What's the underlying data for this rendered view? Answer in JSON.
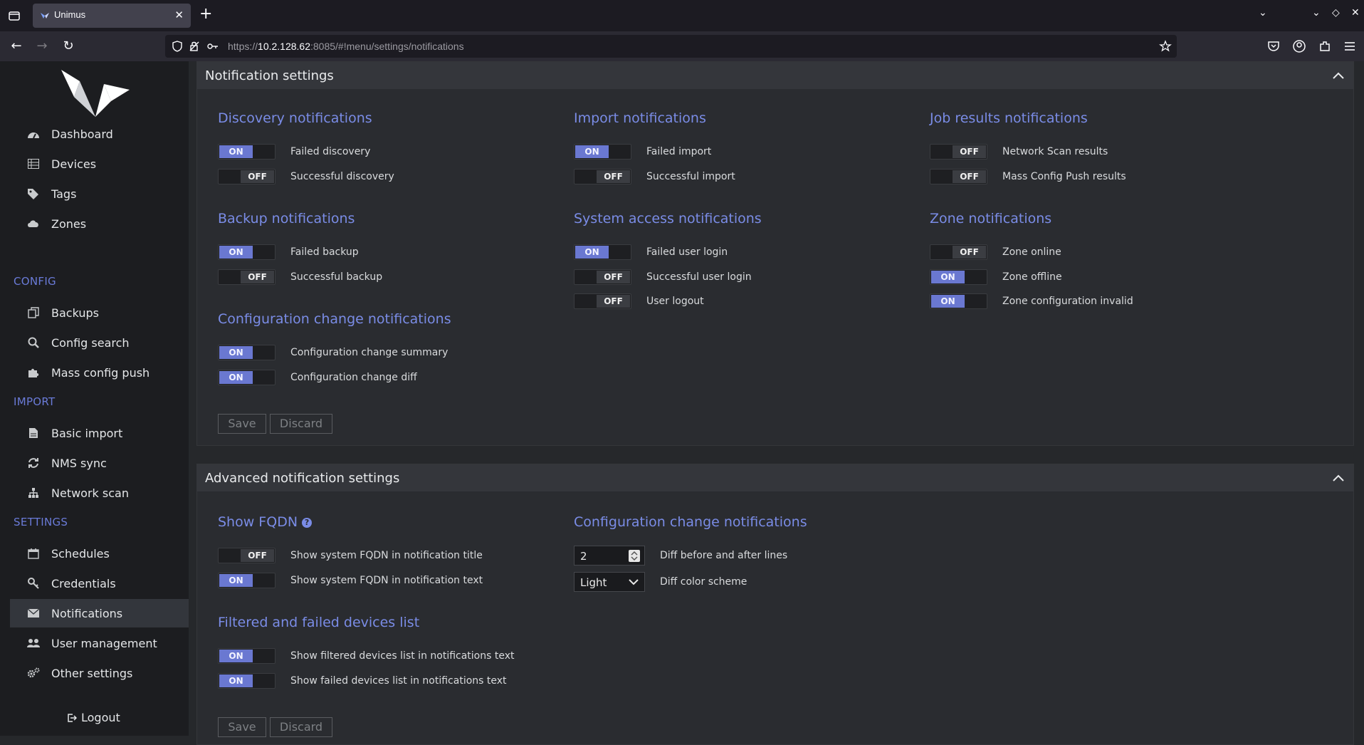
{
  "browser": {
    "tab_title": "Unimus",
    "url_prefix": "https://",
    "url_host": "10.2.128.62",
    "url_rest": ":8085/#!menu/settings/notifications"
  },
  "sidebar": {
    "items": [
      {
        "label": "Dashboard",
        "icon": "dashboard-icon"
      },
      {
        "label": "Devices",
        "icon": "table-icon"
      },
      {
        "label": "Tags",
        "icon": "tags-icon"
      },
      {
        "label": "Zones",
        "icon": "cloud-icon"
      }
    ],
    "config_title": "CONFIG",
    "config_items": [
      {
        "label": "Backups",
        "icon": "copy-icon"
      },
      {
        "label": "Config search",
        "icon": "search-icon"
      },
      {
        "label": "Mass config push",
        "icon": "puzzle-icon"
      }
    ],
    "import_title": "IMPORT",
    "import_items": [
      {
        "label": "Basic import",
        "icon": "file-icon"
      },
      {
        "label": "NMS sync",
        "icon": "refresh-icon"
      },
      {
        "label": "Network scan",
        "icon": "sitemap-icon"
      }
    ],
    "settings_title": "SETTINGS",
    "settings_items": [
      {
        "label": "Schedules",
        "icon": "calendar-icon"
      },
      {
        "label": "Credentials",
        "icon": "key-icon"
      },
      {
        "label": "Notifications",
        "icon": "envelope-icon"
      },
      {
        "label": "User management",
        "icon": "users-icon"
      },
      {
        "label": "Other settings",
        "icon": "gears-icon"
      }
    ],
    "logout": "Logout"
  },
  "notification_panel": {
    "title": "Notification settings",
    "discovery": {
      "title": "Discovery notifications",
      "items": [
        {
          "label": "Failed discovery",
          "state": "ON"
        },
        {
          "label": "Successful discovery",
          "state": "OFF"
        }
      ]
    },
    "import": {
      "title": "Import notifications",
      "items": [
        {
          "label": "Failed import",
          "state": "ON"
        },
        {
          "label": "Successful import",
          "state": "OFF"
        }
      ]
    },
    "job_results": {
      "title": "Job results notifications",
      "items": [
        {
          "label": "Network Scan results",
          "state": "OFF"
        },
        {
          "label": "Mass Config Push results",
          "state": "OFF"
        }
      ]
    },
    "backup": {
      "title": "Backup notifications",
      "items": [
        {
          "label": "Failed backup",
          "state": "ON"
        },
        {
          "label": "Successful backup",
          "state": "OFF"
        }
      ]
    },
    "system_access": {
      "title": "System access notifications",
      "items": [
        {
          "label": "Failed user login",
          "state": "ON"
        },
        {
          "label": "Successful user login",
          "state": "OFF"
        },
        {
          "label": "User logout",
          "state": "OFF"
        }
      ]
    },
    "zone": {
      "title": "Zone notifications",
      "items": [
        {
          "label": "Zone online",
          "state": "OFF"
        },
        {
          "label": "Zone offline",
          "state": "ON"
        },
        {
          "label": "Zone configuration invalid",
          "state": "ON"
        }
      ]
    },
    "config_change": {
      "title": "Configuration change notifications",
      "items": [
        {
          "label": "Configuration change summary",
          "state": "ON"
        },
        {
          "label": "Configuration change diff",
          "state": "ON"
        }
      ]
    },
    "save_label": "Save",
    "discard_label": "Discard"
  },
  "advanced_panel": {
    "title": "Advanced notification settings",
    "fqdn": {
      "title": "Show FQDN",
      "help": "?",
      "items": [
        {
          "label": "Show system FQDN in notification title",
          "state": "OFF"
        },
        {
          "label": "Show system FQDN in notification text",
          "state": "ON"
        }
      ]
    },
    "config_change": {
      "title": "Configuration change notifications",
      "diff_lines_value": "2",
      "diff_lines_label": "Diff before and after lines",
      "color_scheme_value": "Light",
      "color_scheme_label": "Diff color scheme"
    },
    "filtered": {
      "title": "Filtered and failed devices list",
      "items": [
        {
          "label": "Show filtered devices list in notifications text",
          "state": "ON"
        },
        {
          "label": "Show failed devices list in notifications text",
          "state": "ON"
        }
      ]
    },
    "save_label": "Save",
    "discard_label": "Discard"
  },
  "colors": {
    "accent": "#6a78d1",
    "title": "#7a8ce6",
    "sidebar_section": "#6a7bd8"
  }
}
